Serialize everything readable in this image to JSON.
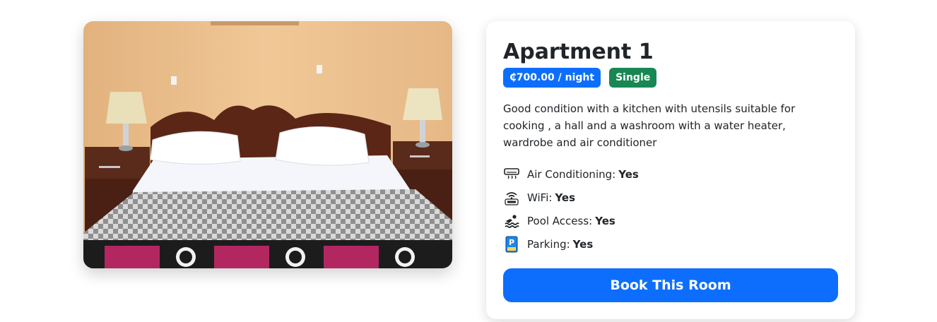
{
  "room": {
    "photo_alt": "Bedroom with double bed, two bedside lamps and patterned blanket",
    "title": "Apartment 1",
    "price_badge": "₵700.00 / night",
    "type_badge": "Single",
    "description": "Good condition with a kitchen with utensils suitable for cooking , a hall and a washroom with a water heater, wardrobe and air conditioner",
    "amenities": [
      {
        "icon": "air-conditioner-icon",
        "label": "Air Conditioning:",
        "value": "Yes"
      },
      {
        "icon": "wifi-icon",
        "label": "WiFi:",
        "value": "Yes"
      },
      {
        "icon": "swimming-icon",
        "label": "Pool Access:",
        "value": "Yes"
      },
      {
        "icon": "parking-icon",
        "label": "Parking:",
        "value": "Yes"
      }
    ],
    "book_label": "Book This Room"
  },
  "colors": {
    "primary": "#0d6efd",
    "success": "#198754"
  }
}
